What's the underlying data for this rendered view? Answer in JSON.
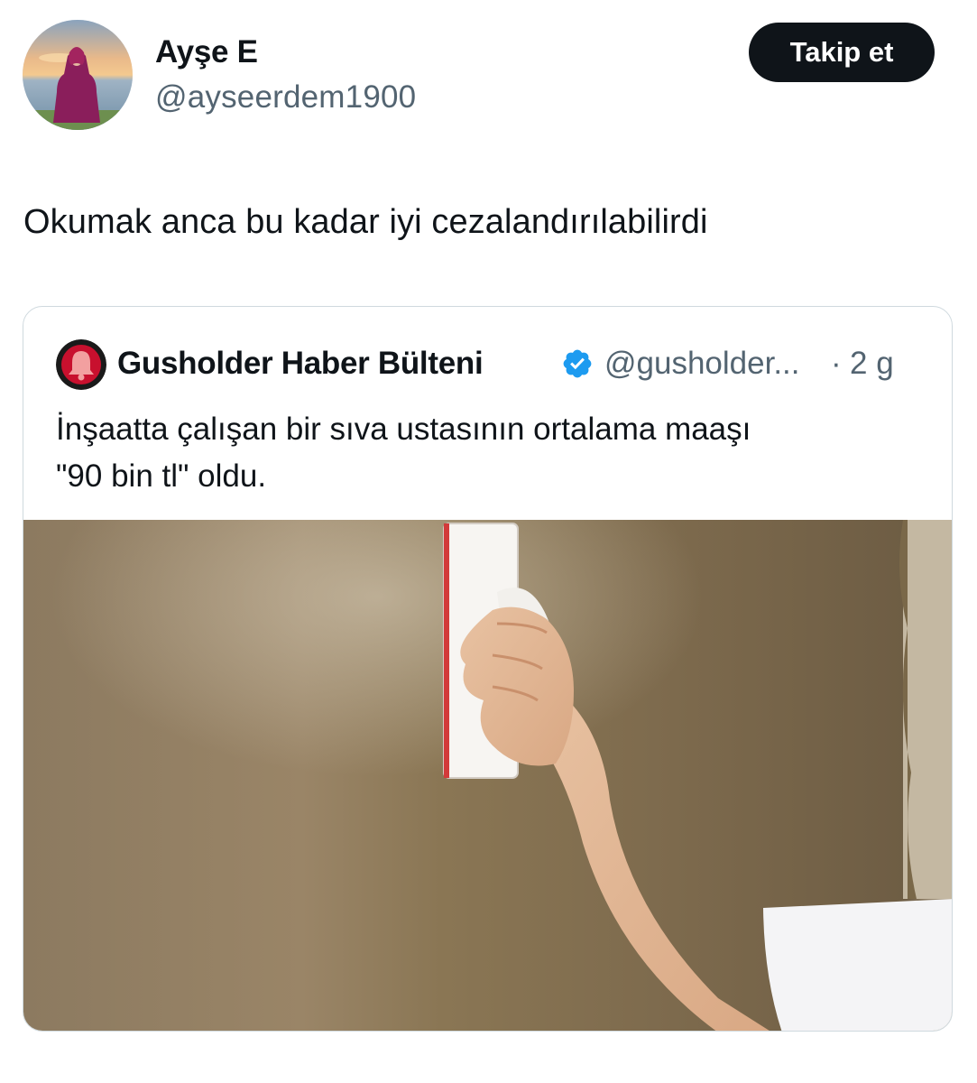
{
  "author": {
    "display_name": "Ayşe E",
    "handle": "@ayseerdem1900"
  },
  "follow_button": {
    "label": "Takip et"
  },
  "tweet": {
    "text": "Okumak anca bu kadar iyi cezalandırılabilirdi"
  },
  "quoted_tweet": {
    "display_name": "Gusholder Haber Bülteni",
    "handle": "@gusholder...",
    "separator": "·",
    "time": "2 g",
    "text_line1": "İnşaatta çalışan bir sıva ustasının ortalama maaşı",
    "text_line2": "\"90 bin tl\" oldu.",
    "verified": true
  },
  "colors": {
    "text_primary": "#0f1419",
    "text_secondary": "#536471",
    "border": "#cfd9de",
    "verified_blue": "#1d9bf0",
    "follow_button_bg": "#0f1419"
  }
}
